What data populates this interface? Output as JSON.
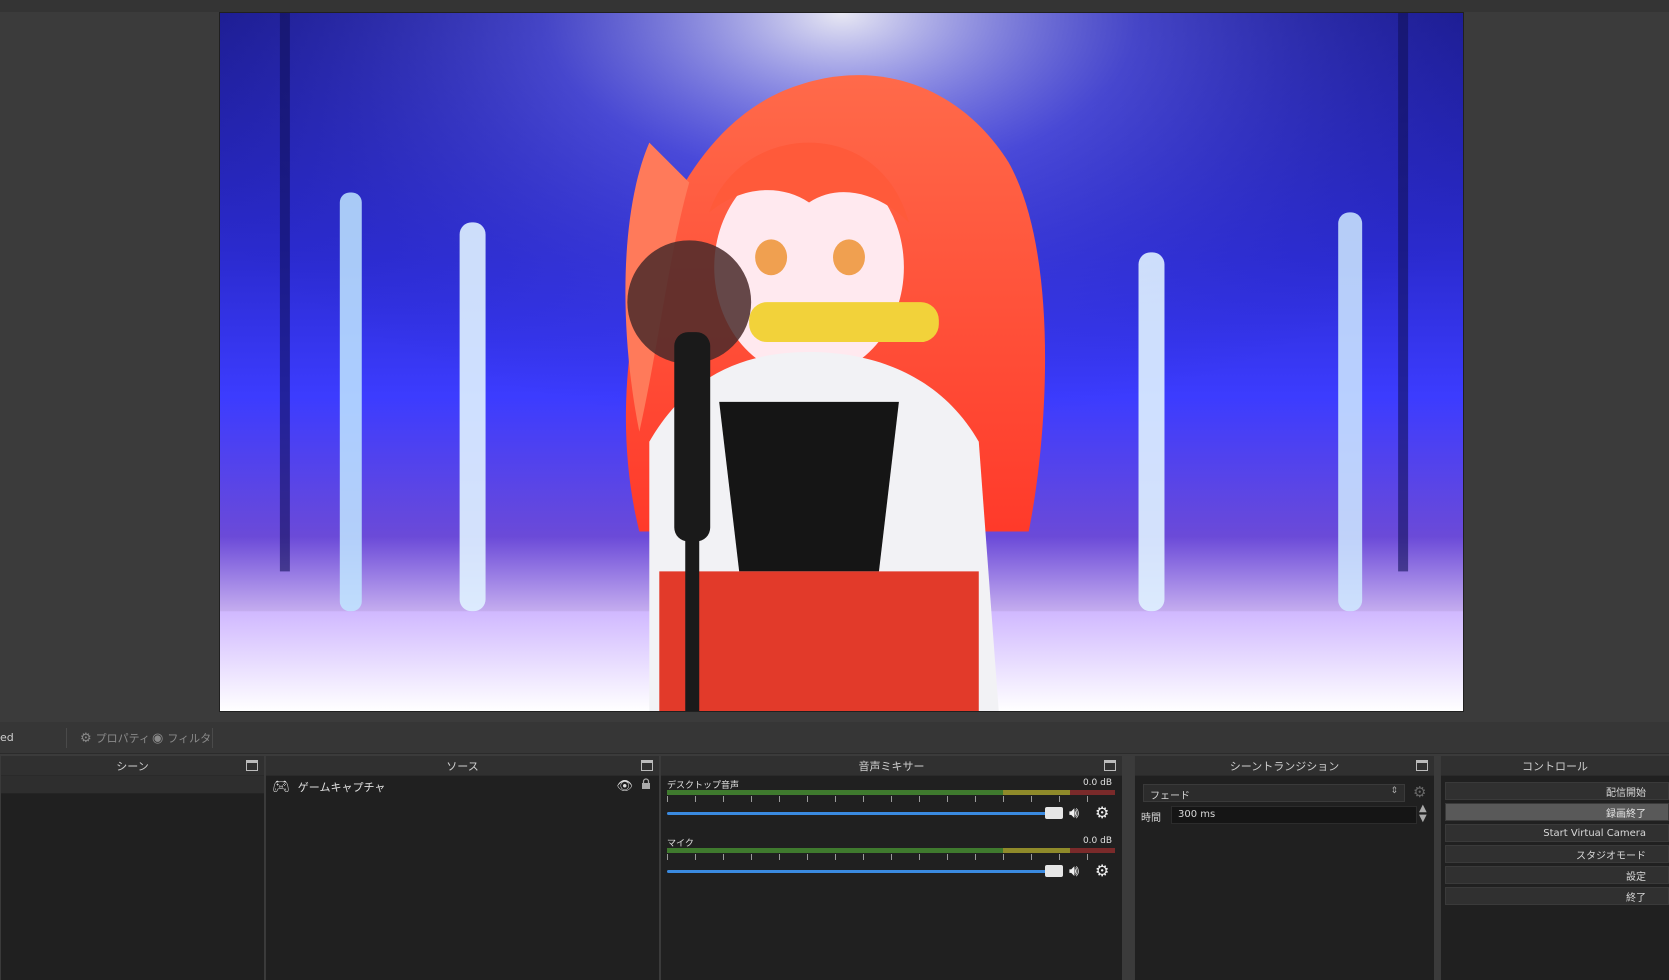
{
  "scene_toolbar": {
    "scene_name_fragment": "ed",
    "properties_label": "プロパティ",
    "filters_label": "フィルタ"
  },
  "docks": {
    "scenes": {
      "title": "シーン"
    },
    "sources": {
      "title": "ソース",
      "items": [
        {
          "label": "ゲームキャプチャ",
          "icon": "gamepad-icon"
        }
      ]
    },
    "mixer": {
      "title": "音声ミキサー",
      "tracks": [
        {
          "name": "デスクトップ音声",
          "db": "0.0 dB"
        },
        {
          "name": "マイク",
          "db": "0.0 dB"
        }
      ]
    },
    "transitions": {
      "title": "シーントランジション",
      "selected": "フェード",
      "duration_label": "時間",
      "duration_value": "300 ms"
    },
    "controls": {
      "title": "コントロール",
      "buttons": [
        {
          "label": "配信開始",
          "active": false
        },
        {
          "label": "録画終了",
          "active": true
        },
        {
          "label": "Start Virtual Camera",
          "active": false
        },
        {
          "label": "スタジオモード",
          "active": false
        },
        {
          "label": "設定",
          "active": false
        },
        {
          "label": "終了",
          "active": false
        }
      ]
    }
  },
  "colors": {
    "background": "#3b3b3b",
    "dock_background": "#202020",
    "meter_green": "#3f7a2e",
    "meter_yellow": "#8f8a2a",
    "meter_red": "#7a2a2a",
    "fader_blue": "#3a8ae0"
  }
}
